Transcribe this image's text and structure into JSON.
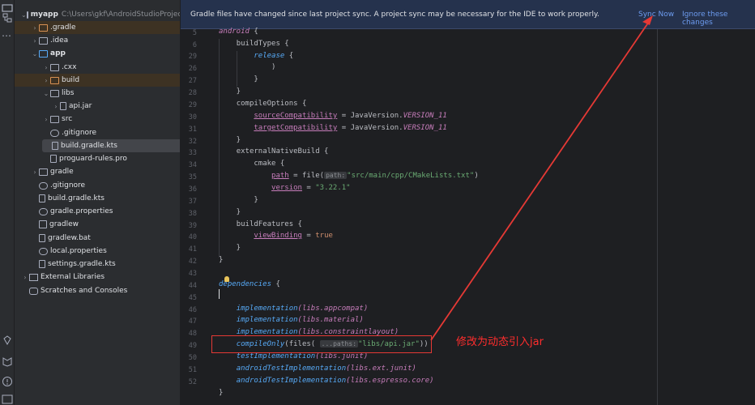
{
  "tree": {
    "root_name": "myapp",
    "root_path": "C:\\Users\\gkf\\AndroidStudioProjects",
    "items": [
      {
        "label": "myapp",
        "path": "C:\\Users\\gkf\\AndroidStudioProjects"
      },
      {
        "label": ".gradle"
      },
      {
        "label": ".idea"
      },
      {
        "label": "app"
      },
      {
        "label": ".cxx"
      },
      {
        "label": "build"
      },
      {
        "label": "libs"
      },
      {
        "label": "api.jar"
      },
      {
        "label": "src"
      },
      {
        "label": ".gitignore"
      },
      {
        "label": "build.gradle.kts"
      },
      {
        "label": "proguard-rules.pro"
      },
      {
        "label": "gradle"
      },
      {
        "label": ".gitignore"
      },
      {
        "label": "build.gradle.kts"
      },
      {
        "label": "gradle.properties"
      },
      {
        "label": "gradlew"
      },
      {
        "label": "gradlew.bat"
      },
      {
        "label": "local.properties"
      },
      {
        "label": "settings.gradle.kts"
      },
      {
        "label": "External Libraries"
      },
      {
        "label": "Scratches and Consoles"
      }
    ]
  },
  "banner": {
    "message": "Gradle files have changed since last project sync. A project sync may be necessary for the IDE to work properly.",
    "sync_now": "Sync Now",
    "ignore": "Ignore these changes"
  },
  "editor": {
    "line_numbers": [
      "5",
      "6",
      "29",
      "26",
      "27",
      "28",
      "29",
      "30",
      "31",
      "32",
      "33",
      "34",
      "35",
      "36",
      "37",
      "38",
      "39",
      "40",
      "41",
      "42",
      "43",
      "44",
      "45",
      "46",
      "47",
      "48",
      "49",
      "50",
      "51",
      "52"
    ],
    "hints": {
      "path": "path:",
      "paths": "...paths:"
    },
    "strings": {
      "cmake_path": "\"src/main/cpp/CMakeLists.txt\"",
      "cmake_version": "\"3.22.1\"",
      "api_jar": "\"libs/api.jar\""
    },
    "tokens": {
      "android": "android",
      "buildTypes": "buildTypes",
      "release": "release",
      "compileOptions": "compileOptions",
      "sourceCompatibility": "sourceCompatibility",
      "targetCompatibility": "targetCompatibility",
      "java_version": "JavaVersion.",
      "version_11": "VERSION_11",
      "externalNativeBuild": "externalNativeBuild",
      "cmake": "cmake",
      "path": "path",
      "file": "file(",
      "version": "version",
      "buildFeatures": "buildFeatures",
      "viewBinding": "viewBinding",
      "true": "true",
      "dependencies": "dependencies",
      "implementation": "implementation",
      "compileOnly": "compileOnly",
      "files": "(files(",
      "testImplementation": "testImplementation",
      "androidTestImplementation": "androidTestImplementation",
      "libs_appcompat": "(libs.appcompat)",
      "libs_material": "(libs.material)",
      "libs_constraintlayout": "(libs.constraintlayout)",
      "libs_junit": "(libs.junit)",
      "libs_ext_junit": "(libs.ext.junit)",
      "libs_espresso": "(libs.espresso.core)"
    }
  },
  "annotation": {
    "text": "修改为动态引入jar",
    "color": "#ff2d2d"
  }
}
